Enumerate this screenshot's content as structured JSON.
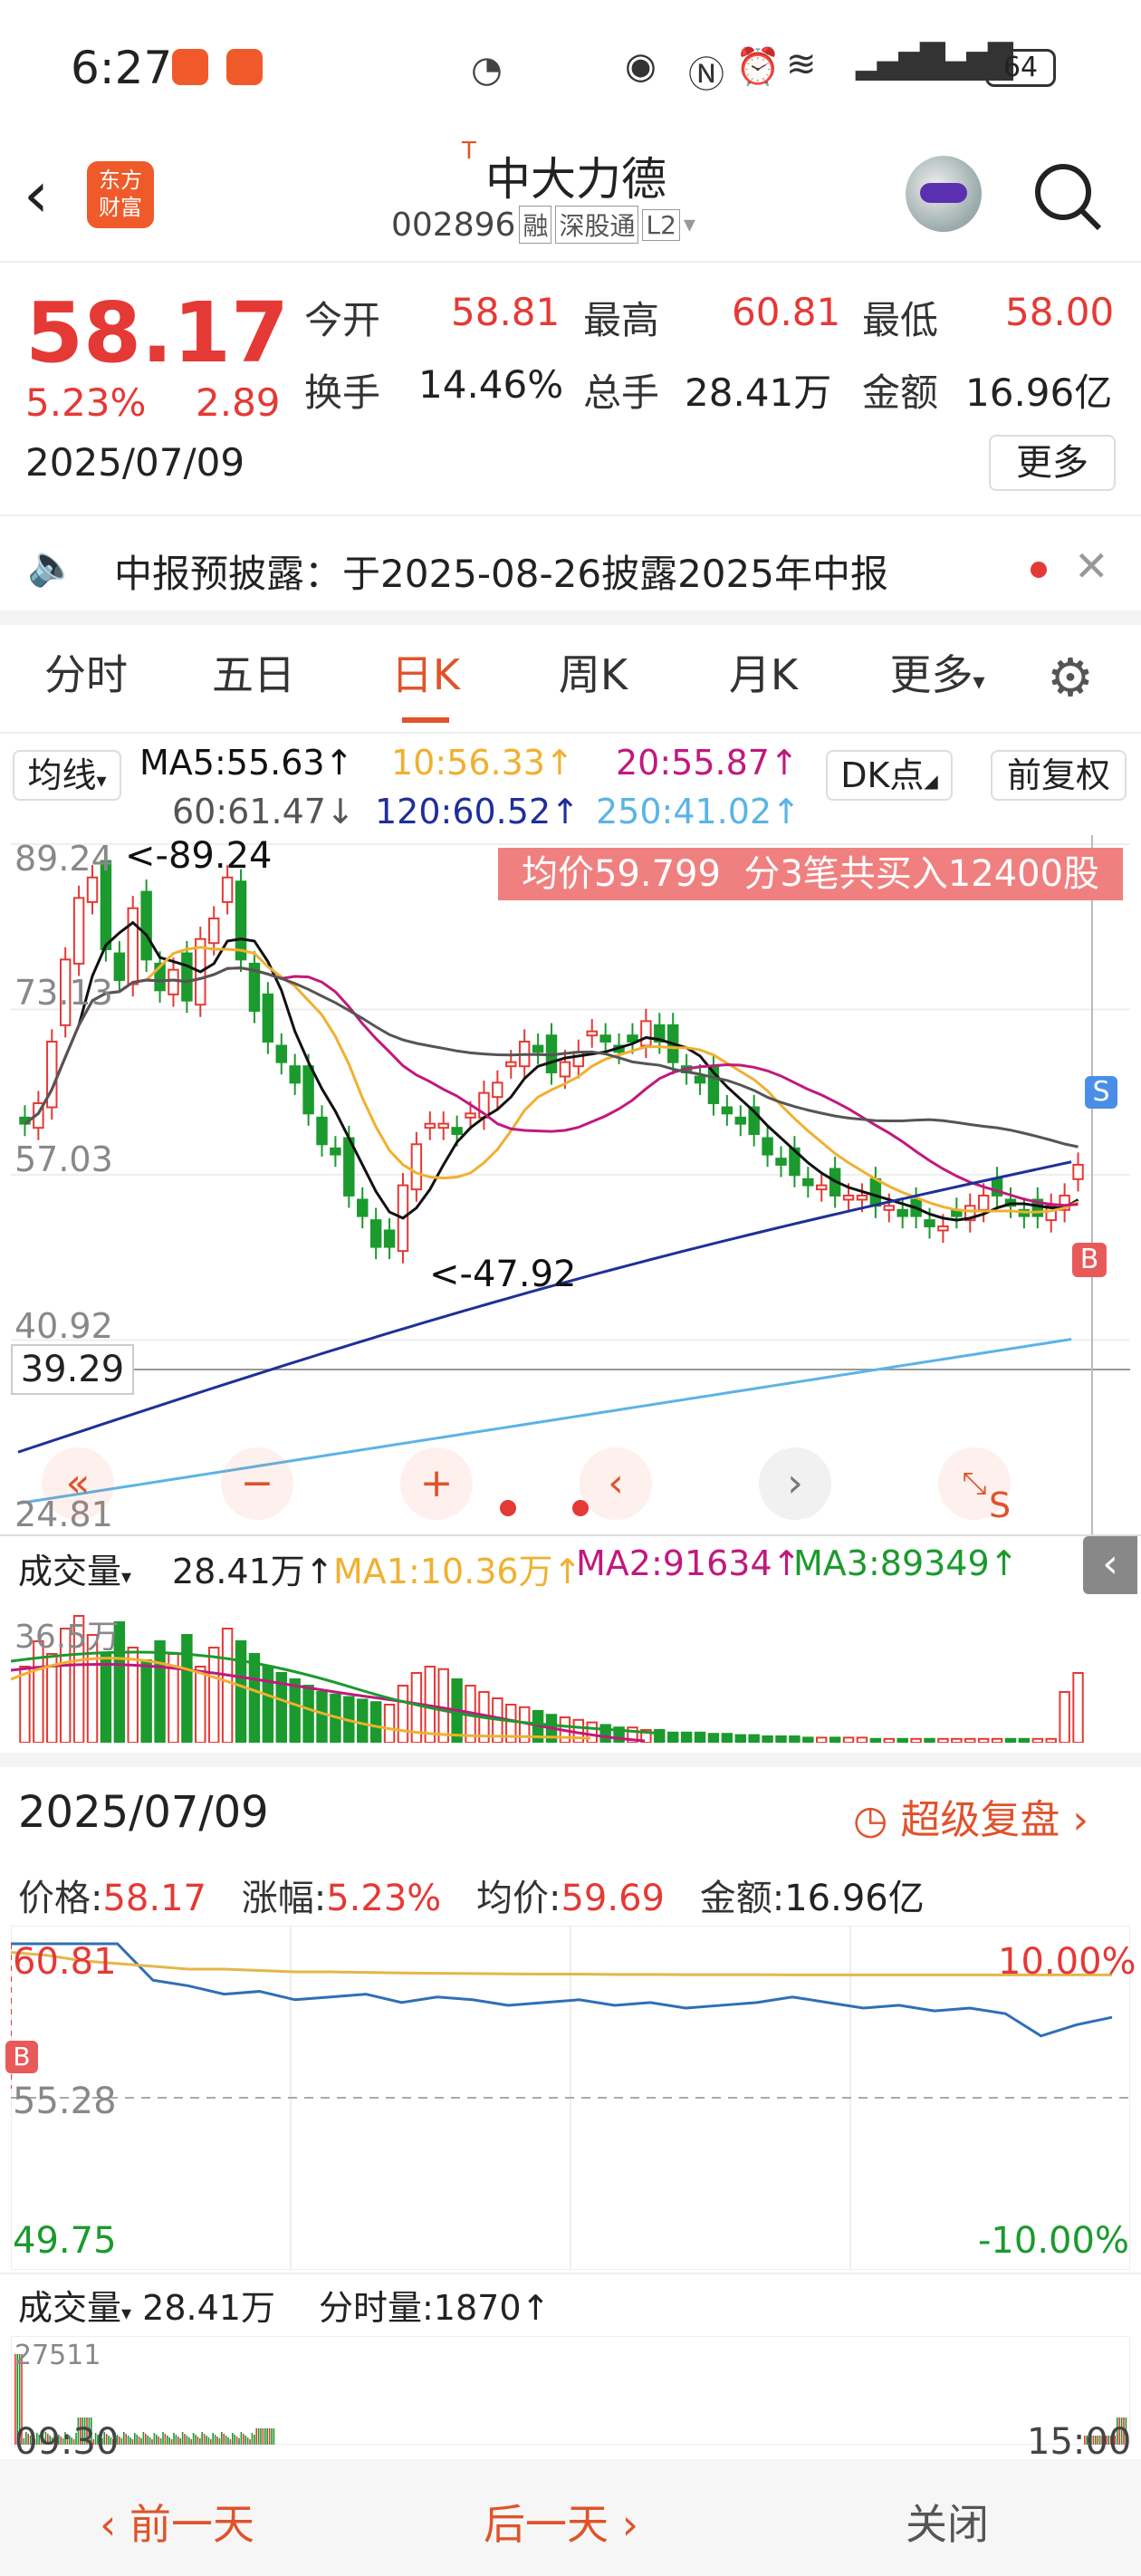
{
  "status": {
    "time": "6:27",
    "battery": "64"
  },
  "header": {
    "title": "中大力德",
    "title_prefix": "T",
    "code": "002896",
    "tags": [
      "融",
      "深股通",
      "L2"
    ],
    "logo": "东方\n财富"
  },
  "quote": {
    "price": "58.17",
    "change_pct": "5.23%",
    "change": "2.89",
    "date": "2025/07/09",
    "labels": {
      "open": "今开",
      "high": "最高",
      "low": "最低",
      "turnover": "换手",
      "volume": "总手",
      "amount": "金额"
    },
    "values": {
      "open": "58.81",
      "high": "60.81",
      "low": "58.00",
      "turnover": "14.46%",
      "volume": "28.41万",
      "amount": "16.96亿"
    },
    "more": "更多"
  },
  "notice": {
    "text": "中报预披露：于2025-08-26披露2025年中报"
  },
  "tabs": [
    "分时",
    "五日",
    "日K",
    "周K",
    "月K",
    "更多"
  ],
  "ma": {
    "selector": "均线",
    "ma5": "MA5:55.63",
    "ma10": "10:56.33",
    "ma20": "20:55.87",
    "ma60": "60:61.47",
    "ma120": "120:60.52",
    "ma250": "250:41.02",
    "dk": "DK点",
    "fq": "前复权"
  },
  "kline": {
    "y_labels": [
      "89.24",
      "73.13",
      "57.03",
      "40.92",
      "24.81"
    ],
    "max_label": "<-89.24",
    "min_label": "<-47.92",
    "crosshair": "39.29",
    "banner": "均价59.799  分3笔共买入12400股",
    "signal_s": "S",
    "signal_b": "B"
  },
  "volume_bar": {
    "selector": "成交量",
    "vol": "28.41万",
    "ma1": "MA1:10.36万",
    "ma2": "MA2:91634",
    "ma3": "MA3:89349",
    "y_label": "36.5万"
  },
  "day": {
    "date": "2025/07/09",
    "replay": "超级复盘",
    "stats": {
      "price_label": "价格:",
      "price": "58.17",
      "pct_label": "涨幅:",
      "pct": "5.23%",
      "avg_label": "均价:",
      "avg": "59.69",
      "amt_label": "金额:",
      "amt": "16.96亿"
    },
    "y_top": "60.81",
    "y_mid": "55.28",
    "y_bot": "49.75",
    "pct_top": "10.00%",
    "pct_bot": "-10.00%",
    "marker": "B",
    "vol_selector": "成交量",
    "vol": "28.41万",
    "tick_vol": "分时量:1870",
    "vol_max": "27511",
    "t_start": "09:30",
    "t_end": "15:00"
  },
  "footer": {
    "prev": "前一天",
    "next": "后一天",
    "close": "关闭"
  },
  "colors": {
    "up": "#e53935",
    "down": "#1b9a2e",
    "accent": "#e0532b",
    "ma5": "#111111",
    "ma10": "#f0b030",
    "ma20": "#c0197e",
    "ma60": "#555555",
    "ma120": "#1f2f99",
    "ma250": "#5ab4e6"
  },
  "chart_data": [
    {
      "type": "line",
      "title": "",
      "y_range": [
        24.81,
        89.24
      ],
      "ohlc_close": [
        62,
        64,
        70,
        78,
        84,
        86,
        79,
        76,
        83,
        78,
        75,
        77,
        74,
        80,
        82,
        86,
        78,
        73,
        70,
        68,
        66,
        63,
        60,
        59,
        55,
        53,
        50,
        50,
        56,
        60,
        62,
        62,
        61,
        63,
        65,
        66,
        68,
        70,
        69,
        67,
        68,
        69,
        71,
        70,
        69,
        70,
        72,
        70,
        68,
        67,
        66,
        64,
        63,
        62,
        61,
        59,
        58,
        57,
        56,
        56,
        55,
        55,
        55,
        54,
        54,
        53,
        53,
        52,
        52,
        53,
        54,
        55,
        55,
        54,
        53,
        53,
        54,
        55,
        58
      ],
      "series": [
        {
          "name": "MA5",
          "value": "55.63"
        },
        {
          "name": "10",
          "value": "56.33"
        },
        {
          "name": "20",
          "value": "55.87"
        },
        {
          "name": "60",
          "value": "61.47"
        },
        {
          "name": "120",
          "value": "60.52"
        },
        {
          "name": "250",
          "value": "41.02"
        }
      ]
    },
    {
      "type": "line",
      "title": "",
      "y_range": [
        49.75,
        60.81
      ],
      "x_range": [
        "09:30",
        "15:00"
      ],
      "series": [
        {
          "name": "价格",
          "values": [
            60.81,
            60.81,
            60.81,
            60.81,
            59.5,
            59.3,
            59.0,
            59.1,
            58.8,
            58.9,
            59.0,
            58.7,
            58.9,
            58.8,
            58.6,
            58.7,
            58.8,
            58.6,
            58.7,
            58.5,
            58.6,
            58.7,
            58.9,
            58.7,
            58.5,
            58.6,
            58.4,
            58.5,
            58.3,
            57.5,
            57.9,
            58.17
          ]
        },
        {
          "name": "均价",
          "values": [
            60.5,
            60.4,
            60.2,
            60.1,
            60.0,
            59.9,
            59.9,
            59.85,
            59.8,
            59.8,
            59.78,
            59.76,
            59.75,
            59.74,
            59.73,
            59.72,
            59.72,
            59.71,
            59.71,
            59.7,
            59.7,
            59.7,
            59.69,
            59.69,
            59.69,
            59.69,
            59.69,
            59.69,
            59.69,
            59.69,
            59.69,
            59.69
          ]
        }
      ]
    }
  ]
}
